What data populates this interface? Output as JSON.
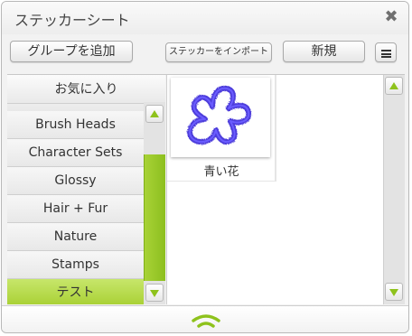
{
  "window": {
    "title": "ステッカーシート",
    "close_icon": "close-x-icon"
  },
  "toolbar": {
    "add_group_label": "グループを追加",
    "import_label": "ステッカーをインポート",
    "new_label": "新規",
    "menu_icon": "list-menu-icon"
  },
  "sidebar": {
    "favorites_label": "お気に入り",
    "items": [
      {
        "label": "Brush Heads"
      },
      {
        "label": "Character Sets"
      },
      {
        "label": "Glossy"
      },
      {
        "label": "Hair + Fur"
      },
      {
        "label": "Nature"
      },
      {
        "label": "Stamps"
      },
      {
        "label": "テスト",
        "selected": true
      }
    ]
  },
  "stickers": [
    {
      "label": "青い花",
      "color": "#3a2bd8"
    }
  ],
  "colors": {
    "accent_green": "#9ccb2a",
    "selected_item": "#b6da4a",
    "sticker_stroke": "#3a2bd8"
  }
}
